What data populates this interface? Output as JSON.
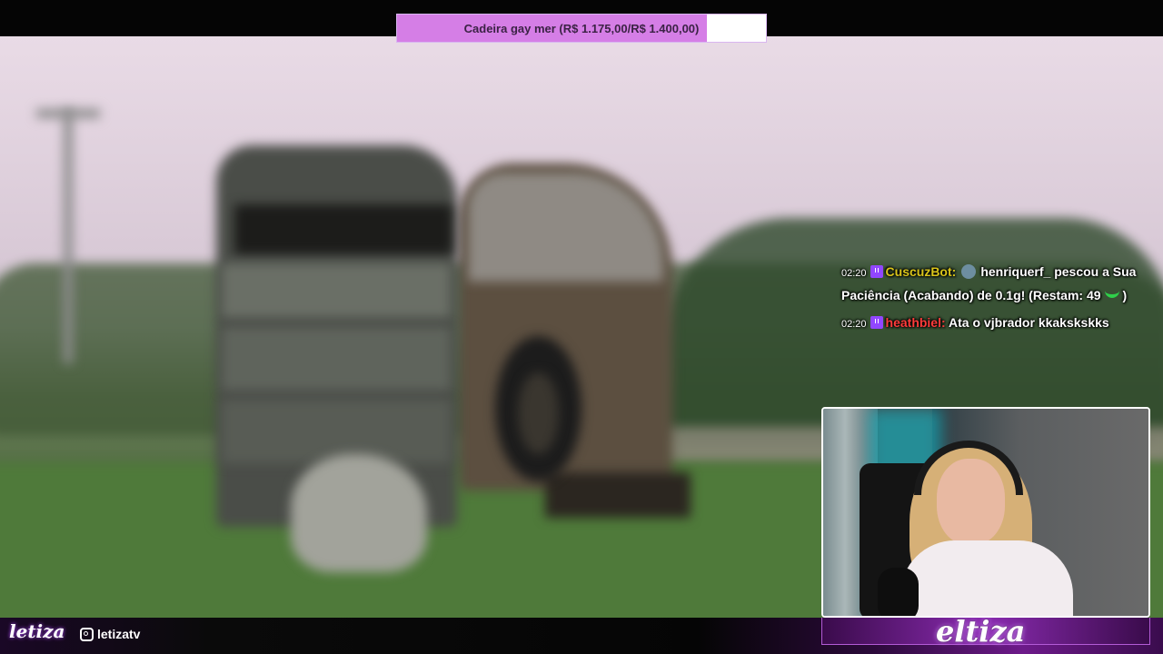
{
  "goal": {
    "text": "Cadeira gay mer (R$ 1.175,00/R$ 1.400,00)",
    "progress_fraction": 0.839,
    "fill_color": "#d57ee6"
  },
  "chat": {
    "messages": [
      {
        "time": "02:20",
        "badge_icon": "twitch-icon",
        "username": "CuscuzBot:",
        "username_color": "#d9c41a",
        "emote": "person-emote",
        "text": "henriquerf_ pescou a Sua Paciência (Acabando) de 0.1g! (Restam: 49",
        "suffix_emote": "snake-emote",
        "suffix": ")"
      },
      {
        "time": "02:20",
        "badge_icon": "twitch-icon",
        "username": "heathbiel:",
        "username_color": "#ff3b3b",
        "text": "Ata o vjbrador kkakskskks"
      }
    ]
  },
  "footer": {
    "logo_left": "letiza",
    "instagram_handle": "letizatv",
    "logo_right": "eltiza"
  }
}
